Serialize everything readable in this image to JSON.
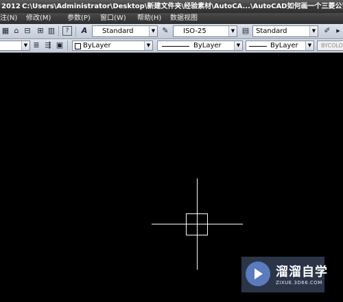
{
  "titlebar": {
    "version": "2012",
    "path": "C:\\Users\\Administrator\\Desktop\\新建文件夹\\经验素材\\AutoCA...\\AutoCAD如何画一个三菱公司标志.dwg"
  },
  "menu": {
    "items": [
      "注(N)",
      "修改(M)",
      "参数(P)",
      "窗口(W)",
      "帮助(H)",
      "数据视图"
    ]
  },
  "toolbar1": {
    "text_style": "Standard",
    "dim_style": "ISO-25",
    "table_style": "Standard"
  },
  "toolbar2": {
    "color": "ByLayer",
    "linetype": "ByLayer",
    "lineweight": "ByLayer",
    "plot_style": "BYCOLOR"
  },
  "watermark": {
    "name": "溜溜自学",
    "url": "ZIXUE.3D66.COM"
  },
  "colors": {
    "canvas": "#000000",
    "crosshair": "#ffffff",
    "toolbar": "#d4dae4",
    "titlebar": "#3c3c3c"
  }
}
